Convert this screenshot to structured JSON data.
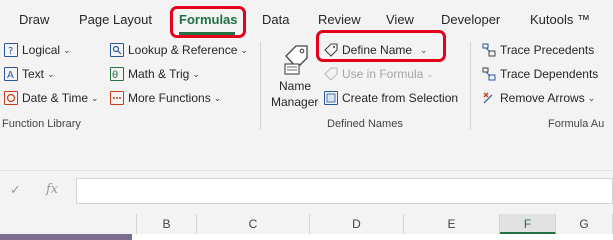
{
  "tabs": [
    {
      "label": "Draw"
    },
    {
      "label": "Page Layout"
    },
    {
      "label": "Formulas",
      "active": true
    },
    {
      "label": "Data"
    },
    {
      "label": "Review"
    },
    {
      "label": "View"
    },
    {
      "label": "Developer"
    },
    {
      "label": "Kutools ™"
    }
  ],
  "function_library": {
    "logical": "Logical",
    "text": "Text",
    "date_time": "Date & Time",
    "lookup": "Lookup & Reference",
    "math": "Math & Trig",
    "more": "More Functions",
    "group_label": "Function Library"
  },
  "defined_names": {
    "name_manager_line1": "Name",
    "name_manager_line2": "Manager",
    "define_name": "Define Name",
    "use_in_formula": "Use in Formula",
    "create_from_selection": "Create from Selection",
    "group_label": "Defined Names"
  },
  "formula_auditing": {
    "trace_precedents": "Trace Precedents",
    "trace_dependents": "Trace Dependents",
    "remove_arrows": "Remove Arrows",
    "group_label": "Formula Au"
  },
  "formula_bar": {
    "cancel": "✓",
    "fx": "fx",
    "value": ""
  },
  "columns": [
    "B",
    "C",
    "D",
    "E",
    "F",
    "G"
  ],
  "active_column": "F",
  "colors": {
    "accent": "#217346",
    "annotation": "#e3001b"
  }
}
